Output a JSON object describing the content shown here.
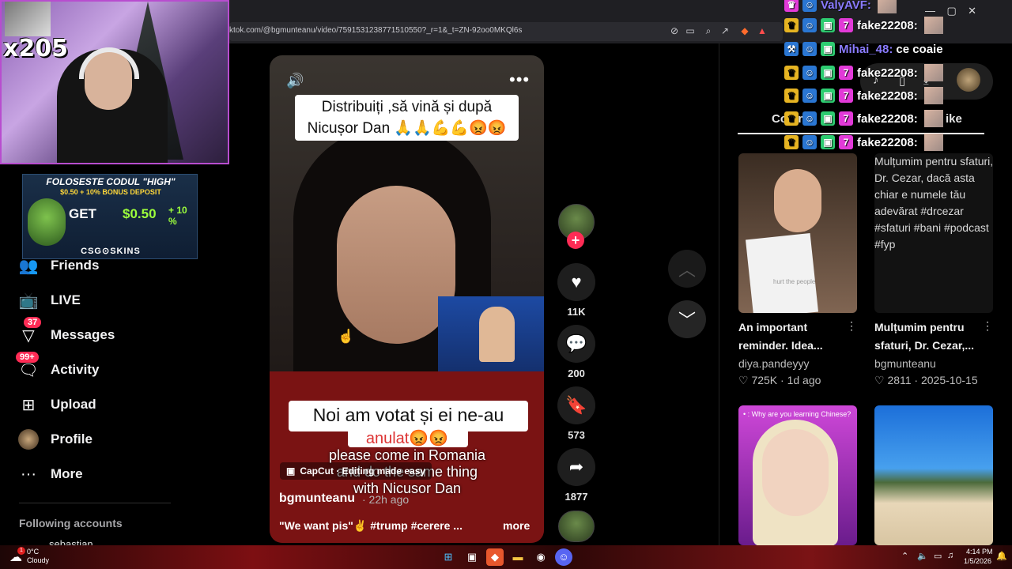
{
  "browser": {
    "url": "ktok.com/@bgmunteanu/video/7591531238771510550?_r=1&_t=ZN-92oo0MKQl6s"
  },
  "stream_overlay": {
    "multiplier": "x205",
    "promo": {
      "title": "FOLOSESTE CODUL \"HIGH\"",
      "subtitle": "$0.50 + 10% BONUS DEPOSIT",
      "get": "GET",
      "amount": "$0.50",
      "plus": "+ 10 %",
      "brand": "CSG⊙SKINS"
    },
    "chat": [
      {
        "name": "ValyAVF:",
        "message": "",
        "name_color": "#8a7bff"
      },
      {
        "name": "fake22208:",
        "message": "",
        "name_color": "#ffffff"
      },
      {
        "name": "Mihai_48:",
        "message": "ce coaie",
        "name_color": "#8a7bff"
      },
      {
        "name": "fake22208:",
        "message": "",
        "name_color": "#ffffff"
      },
      {
        "name": "fake22208:",
        "message": "",
        "name_color": "#ffffff"
      },
      {
        "name": "fake22208:",
        "message": "",
        "name_color": "#ffffff"
      },
      {
        "name": "fake22208:",
        "message": "",
        "name_color": "#ffffff"
      }
    ]
  },
  "sidebar": {
    "items": [
      {
        "label": "Friends",
        "icon": "friends-icon",
        "badge": ""
      },
      {
        "label": "LIVE",
        "icon": "live-icon",
        "badge": ""
      },
      {
        "label": "Messages",
        "icon": "messages-icon",
        "badge": "37"
      },
      {
        "label": "Activity",
        "icon": "activity-icon",
        "badge": "99+"
      },
      {
        "label": "Upload",
        "icon": "upload-icon",
        "badge": ""
      },
      {
        "label": "Profile",
        "icon": "profile-icon",
        "badge": ""
      },
      {
        "label": "More",
        "icon": "more-icon",
        "badge": ""
      }
    ],
    "following_label": "Following accounts",
    "following_user": "sebastian"
  },
  "video": {
    "caption_top_line1": "Distribuiți ,să vină și după",
    "caption_top_line2": "Nicușor Dan 🙏🙏💪💪😡😡",
    "caption_mid": "Noi am votat și ei ne-au",
    "caption_mid2": "anulat😡😡",
    "subtitle_line1": "please come in Romania",
    "subtitle_line2": "and do the same thing",
    "subtitle_line3": "with Nicusor Dan",
    "capcut": "CapCut · Editing made easy",
    "author": "bgmunteanu",
    "posted": "· 22h ago",
    "description": "\"We want pis\"✌ #trump #cerere ...",
    "more": "more"
  },
  "actions": {
    "likes": "11K",
    "comments": "200",
    "saves": "573",
    "shares": "1877"
  },
  "right_panel": {
    "tab_left": "Comm",
    "tab_right": "ike",
    "cards": [
      {
        "title": "An important reminder. Idea...",
        "user": "diya.pandeyyy",
        "meta": "♡ 725K · 1d ago",
        "thumb_caption": "hurt the people"
      },
      {
        "title": "Mulțumim pentru sfaturi, Dr. Cezar,...",
        "user": "bgmunteanu",
        "meta": "♡ 2811 · 2025-10-15",
        "alt_text": "Mulțumim pentru sfaturi, Dr. Cezar, dacă asta chiar e numele tău adevărat #drcezar #sfaturi #bani #podcast #fyp"
      },
      {
        "thumb_caption": "• : Why are you learning Chinese?"
      },
      {
        "thumb_caption": ""
      }
    ]
  },
  "taskbar": {
    "weather_temp": "0°C",
    "weather_desc": "Cloudy",
    "weather_badge": "1",
    "time": "4:14 PM",
    "date": "1/5/2026"
  },
  "colors": {
    "accent": "#fe2c55",
    "background": "#000000"
  }
}
